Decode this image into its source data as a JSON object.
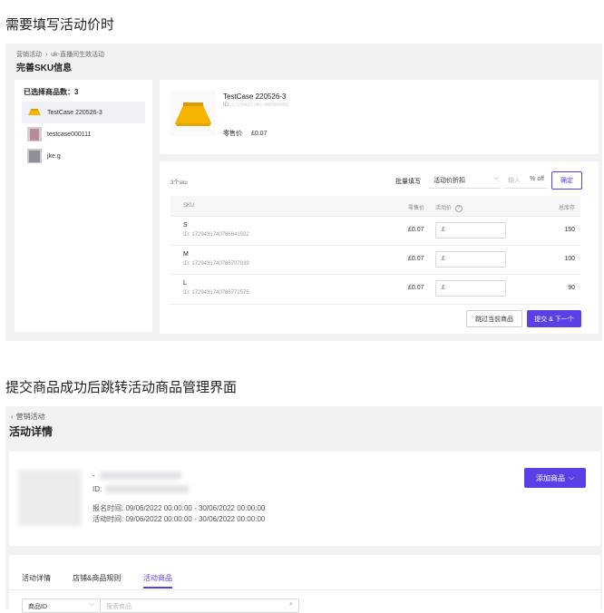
{
  "section1": {
    "heading": "需要填写活动价时"
  },
  "sku_page": {
    "breadcrumb": [
      "营销活动",
      "uk-直播间生效活动"
    ],
    "breadcrumb_sep": "›",
    "title": "完善SKU信息",
    "selected_label": "已选择商品数：3",
    "products": [
      {
        "name": "TestCase 220526-3",
        "thumb": "yellow-skirt"
      },
      {
        "name": "testcase000111",
        "thumb": "pink-clothes"
      },
      {
        "name": "jke.g",
        "thumb": "gray-clothes"
      }
    ],
    "detail": {
      "name": "TestCase 220526-3",
      "id_label": "ID:",
      "id_value": "1729431740786064950",
      "price_label": "零售价",
      "price_value": "£0.07"
    },
    "sku_count": "3个sku",
    "batch_label": "批量填写",
    "batch_select": "活动价折扣",
    "batch_input_placeholder": "输入",
    "batch_suffix": "% off",
    "confirm_label": "确定",
    "table_headers": {
      "sku": "SKU",
      "retail": "零售价",
      "activity": "活动价",
      "stock": "总库存"
    },
    "rows": [
      {
        "sku": "S",
        "id": "ID: 1729431740786641502",
        "retail": "£0.07",
        "currency": "£",
        "stock": "150"
      },
      {
        "sku": "M",
        "id": "ID: 1729431740786707039",
        "retail": "£0.07",
        "currency": "£",
        "stock": "100"
      },
      {
        "sku": "L",
        "id": "ID: 1729431740786772575",
        "retail": "£0.07",
        "currency": "£",
        "stock": "90"
      }
    ],
    "skip_label": "跳过当前商品",
    "submit_label": "提交 & 下一个",
    "colors": {
      "accent": "#5b3fe6",
      "page_bg": "#f2f2f4"
    }
  },
  "section2": {
    "heading": "提交商品成功后跳转活动商品管理界面"
  },
  "detail_page": {
    "back_label": "营销活动",
    "back_icon": "chevron-left-icon",
    "title": "活动详情",
    "name_prefix": "-",
    "id_label": "ID:",
    "signup_time": "报名时间: 09/06/2022 00:00:00 - 30/06/2022 00:00:00",
    "activity_time": "活动时间: 09/06/2022 00:00:00 - 30/06/2022 00:00:00",
    "add_button": "添加商品",
    "tabs": [
      "活动详情",
      "店铺&商品规则",
      "活动商品"
    ],
    "active_tab": 2,
    "filter_select": "商品ID",
    "search_placeholder": "搜索商品"
  }
}
